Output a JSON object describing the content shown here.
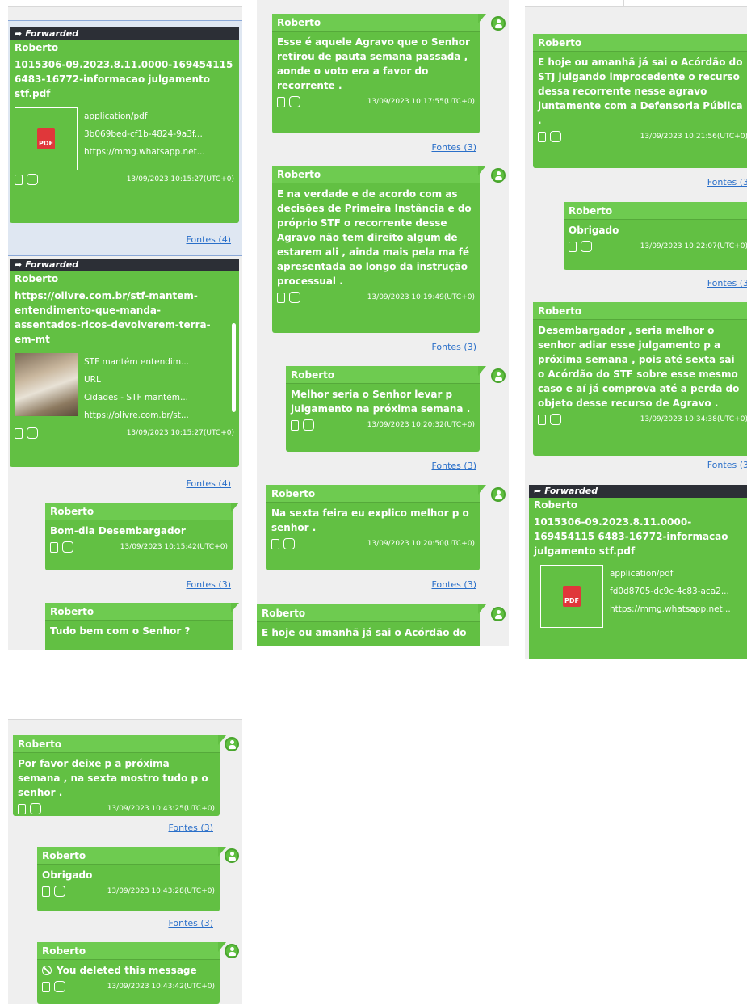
{
  "sender": "Roberto",
  "forwarded_label": "Forwarded",
  "panel1": {
    "msg1": {
      "text": "1015306-09.2023.8.11.0000-169454115 6483-16772-informacao julgamento stf.pdf",
      "attachment": {
        "type": "application/pdf",
        "id": "3b069bed-cf1b-4824-9a3f...",
        "url": "https://mmg.whatsapp.net..."
      },
      "time": "13/09/2023 10:15:27(UTC+0)",
      "fontes": "Fontes (4)"
    },
    "msg2": {
      "text": "https://olivre.com.br/stf-mantem-entendimento-que-manda-assentados-ricos-devolverem-terra-em-mt",
      "attachment": {
        "title": "STF mantém entendim...",
        "type": "URL",
        "desc": "Cidades - STF mantém...",
        "url": "https://olivre.com.br/st..."
      },
      "time": "13/09/2023 10:15:27(UTC+0)",
      "fontes": "Fontes (4)"
    },
    "msg3": {
      "text": "Bom-dia Desembargador",
      "time": "13/09/2023 10:15:42(UTC+0)",
      "fontes": "Fontes (3)"
    },
    "msg4": {
      "text": "Tudo bem com o Senhor ?"
    }
  },
  "panel2": {
    "msg1": {
      "text": "Esse é aquele Agravo que o Senhor retirou de pauta semana passada , aonde o voto era a favor do recorrente .",
      "time": "13/09/2023 10:17:55(UTC+0)",
      "fontes": "Fontes (3)"
    },
    "msg2": {
      "text": "E na verdade e de acordo com as decisões de Primeira Instância e do próprio STF o recorrente desse Agravo não tem direito algum de estarem ali , ainda mais pela ma fé apresentada ao longo da instrução processual .",
      "time": "13/09/2023 10:19:49(UTC+0)",
      "fontes": "Fontes (3)"
    },
    "msg3": {
      "text": "Melhor seria o Senhor levar p julgamento na próxima semana .",
      "time": "13/09/2023 10:20:32(UTC+0)",
      "fontes": "Fontes (3)"
    },
    "msg4": {
      "text": "Na sexta feira eu explico melhor p o senhor .",
      "time": "13/09/2023 10:20:50(UTC+0)",
      "fontes": "Fontes (3)"
    },
    "msg5": {
      "text": "E hoje ou amanhã já sai o Acórdão do"
    }
  },
  "panel3": {
    "msg1": {
      "text": "E hoje ou amanhã já sai o Acórdão do STJ julgando improcedente o recurso dessa recorrente nesse agravo juntamente com a Defensoria Pública .",
      "time": "13/09/2023 10:21:56(UTC+0)",
      "fontes": "Fontes (3"
    },
    "msg2": {
      "text": "Obrigado",
      "time": "13/09/2023 10:22:07(UTC+0)",
      "fontes": "Fontes (3"
    },
    "msg3": {
      "text": "Desembargador , seria melhor o senhor adiar esse julgamento p a próxima semana , pois até sexta sai o Acórdão do STF sobre esse mesmo caso e aí já comprova até a perda do objeto desse recurso de Agravo .",
      "time": "13/09/2023 10:34:38(UTC+0)",
      "fontes": "Fontes (3"
    },
    "msg4": {
      "text": "1015306-09.2023.8.11.0000-169454115 6483-16772-informacao julgamento stf.pdf",
      "attachment": {
        "type": "application/pdf",
        "id": "fd0d8705-dc9c-4c83-aca2...",
        "url": "https://mmg.whatsapp.net..."
      }
    }
  },
  "panel4": {
    "msg1": {
      "text": "Por favor deixe p a próxima semana , na sexta mostro tudo p o senhor .",
      "time": "13/09/2023 10:43:25(UTC+0)",
      "fontes": "Fontes (3)"
    },
    "msg2": {
      "text": "Obrigado",
      "time": "13/09/2023 10:43:28(UTC+0)",
      "fontes": "Fontes (3)"
    },
    "msg3": {
      "text": "You deleted this message",
      "time": "13/09/2023 10:43:42(UTC+0)"
    }
  },
  "pdf_icon_label": "PDF"
}
